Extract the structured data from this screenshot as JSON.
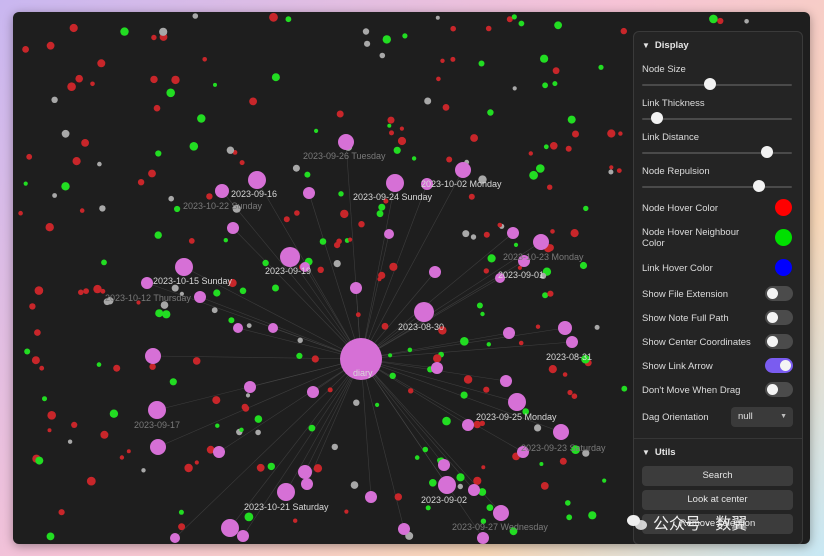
{
  "graph": {
    "center_label": "diary",
    "labels": [
      "2023-09-26 Tuesday",
      "2023-09-16",
      "2023-10-22 Sunday",
      "2023-09-24 Sunday",
      "2023-10-02 Monday",
      "2023-09-19",
      "2023-10-15 Sunday",
      "2023-10-12 Thursday",
      "2023-10-23 Monday",
      "2023-09-01",
      "2023-08-30",
      "2023-08-31",
      "2023-09-25 Monday",
      "2023-09-17",
      "2023-09-23 Saturday",
      "2023-09-02",
      "2023-10-21 Saturday",
      "2023-09-27 Wednesday"
    ]
  },
  "panel": {
    "display_title": "Display",
    "node_size_label": "Node Size",
    "link_thickness_label": "Link Thickness",
    "link_distance_label": "Link Distance",
    "node_repulsion_label": "Node Repulsion",
    "node_size_value": 0.45,
    "link_thickness_value": 0.1,
    "link_distance_value": 0.83,
    "node_repulsion_value": 0.78,
    "node_hover_color_label": "Node Hover Color",
    "node_hover_neighbour_color_label": "Node Hover Neighbour Color",
    "link_hover_color_label": "Link Hover Color",
    "node_hover_color": "#ff0000",
    "node_hover_neighbour_color": "#00e000",
    "link_hover_color": "#0000ff",
    "show_file_extension_label": "Show File Extension",
    "show_note_full_path_label": "Show Note Full Path",
    "show_center_coordinates_label": "Show Center Coordinates",
    "show_link_arrow_label": "Show Link Arrow",
    "dont_move_when_drag_label": "Don't Move When Drag",
    "dag_orientation_label": "Dag Orientation",
    "dag_orientation_value": "null",
    "utils_title": "Utils",
    "search_button": "Search",
    "look_at_center_button": "Look at center",
    "remove_selection_button": "Remove selection"
  },
  "watermark": {
    "text": "公众号 · 数翼"
  },
  "colors": {
    "accent": "#7a5cf0",
    "node_pink": "#d670d6",
    "node_green": "#22dd22",
    "node_red": "#c8262a",
    "node_grey": "#a8a8a8"
  }
}
